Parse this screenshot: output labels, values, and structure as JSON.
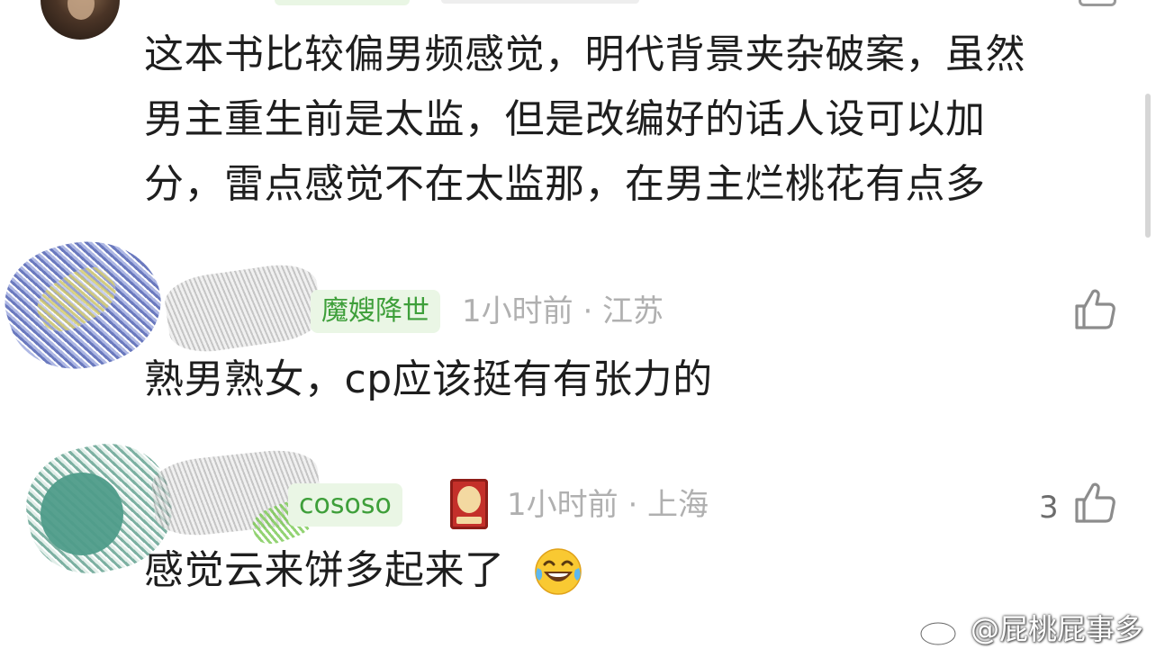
{
  "comments": [
    {
      "text_lines": [
        "这本书比较偏男频感觉，明代背景夹杂破案，虽然",
        "男主重生前是太监，但是改编好的话人设可以加",
        "分，雷点感觉不在太监那，在男主烂桃花有点多"
      ]
    },
    {
      "badge": "魔嫂降世",
      "meta": "1小时前 · 江苏",
      "text": "熟男熟女，cp应该挺有有张力的"
    },
    {
      "badge": "cososo",
      "meta": "1小时前 · 上海",
      "like_count": "3",
      "text": "感觉云来饼多起来了"
    }
  ],
  "watermark": {
    "text": "@屁桃屁事多"
  },
  "colors": {
    "badge_bg": "#eaf6e5",
    "badge_text": "#3e9f3a",
    "meta_text": "#b0b0b0",
    "body_text": "#1e1e1e"
  },
  "icons": [
    "like-icon",
    "medal-icon",
    "laughing-tears-emoji",
    "weibo-logo-icon"
  ]
}
